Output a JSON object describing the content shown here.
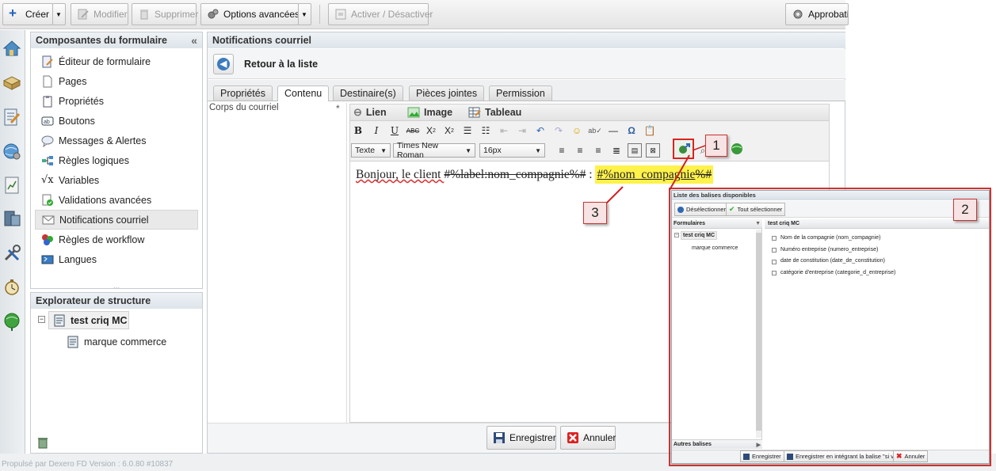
{
  "toolbar": {
    "create": "Créer",
    "modify": "Modifier",
    "delete": "Supprimer",
    "advanced": "Options avancées",
    "toggle": "Activer / Désactiver",
    "approval": "Approbatio"
  },
  "left": {
    "components_title": "Composantes du formulaire",
    "components": [
      "Éditeur de formulaire",
      "Pages",
      "Propriétés",
      "Boutons",
      "Messages & Alertes",
      "Règles logiques",
      "Variables",
      "Validations avancées",
      "Notifications courriel",
      "Règles de workflow",
      "Langues"
    ],
    "selected": "Notifications courriel",
    "explorer_title": "Explorateur de structure",
    "tree_root": "test criq MC",
    "tree_child": "marque commerce"
  },
  "main": {
    "title": "Notifications courriel",
    "back": "Retour à la liste",
    "tabs": [
      "Propriétés",
      "Contenu",
      "Destinaire(s)",
      "Pièces jointes",
      "Permission"
    ],
    "active_tab": "Contenu",
    "body_label": "Corps du courriel",
    "required": "*",
    "editor_tabs": [
      "Lien",
      "Image",
      "Tableau"
    ],
    "format": "Texte",
    "font": "Times New Roman",
    "size": "16px",
    "content_prefix": "Bonjour, le client ",
    "content_struck": "#%label:nom_compagnie%#",
    "content_sep": " : ",
    "content_tag_a": "#%nom_compagnie",
    "content_tag_b": "%#",
    "save": "Enregistrer",
    "cancel": "Annuler"
  },
  "modal": {
    "title": "Liste des balises disponibles",
    "deselect": "Désélectionner",
    "select_all": "Tout sélectionner",
    "col_forms": "Formulaires",
    "col_right": "test criq MC",
    "form_root": "test criq MC",
    "form_child": "marque commerce",
    "fields": [
      "Nom de la compagnie (nom_compagnie)",
      "Numéro entreprise (numero_entreprise)",
      "date de constitution (date_de_constitution)",
      "catégorie d'entreprise (categorie_d_entreprise)"
    ],
    "other_tags": "Autres balises",
    "save": "Enregistrer",
    "save_integrate": "Enregistrer en intégrant la balise \"si vide\"",
    "cancel": "Annuler"
  },
  "callouts": [
    "1",
    "2",
    "3"
  ],
  "footer": "Propulsé par Dexero FD Version : 6.0.80 #10837",
  "colors": {
    "highlight": "#fff24a",
    "callout_border": "#cc3333",
    "panel_head": "#dde4ea"
  }
}
